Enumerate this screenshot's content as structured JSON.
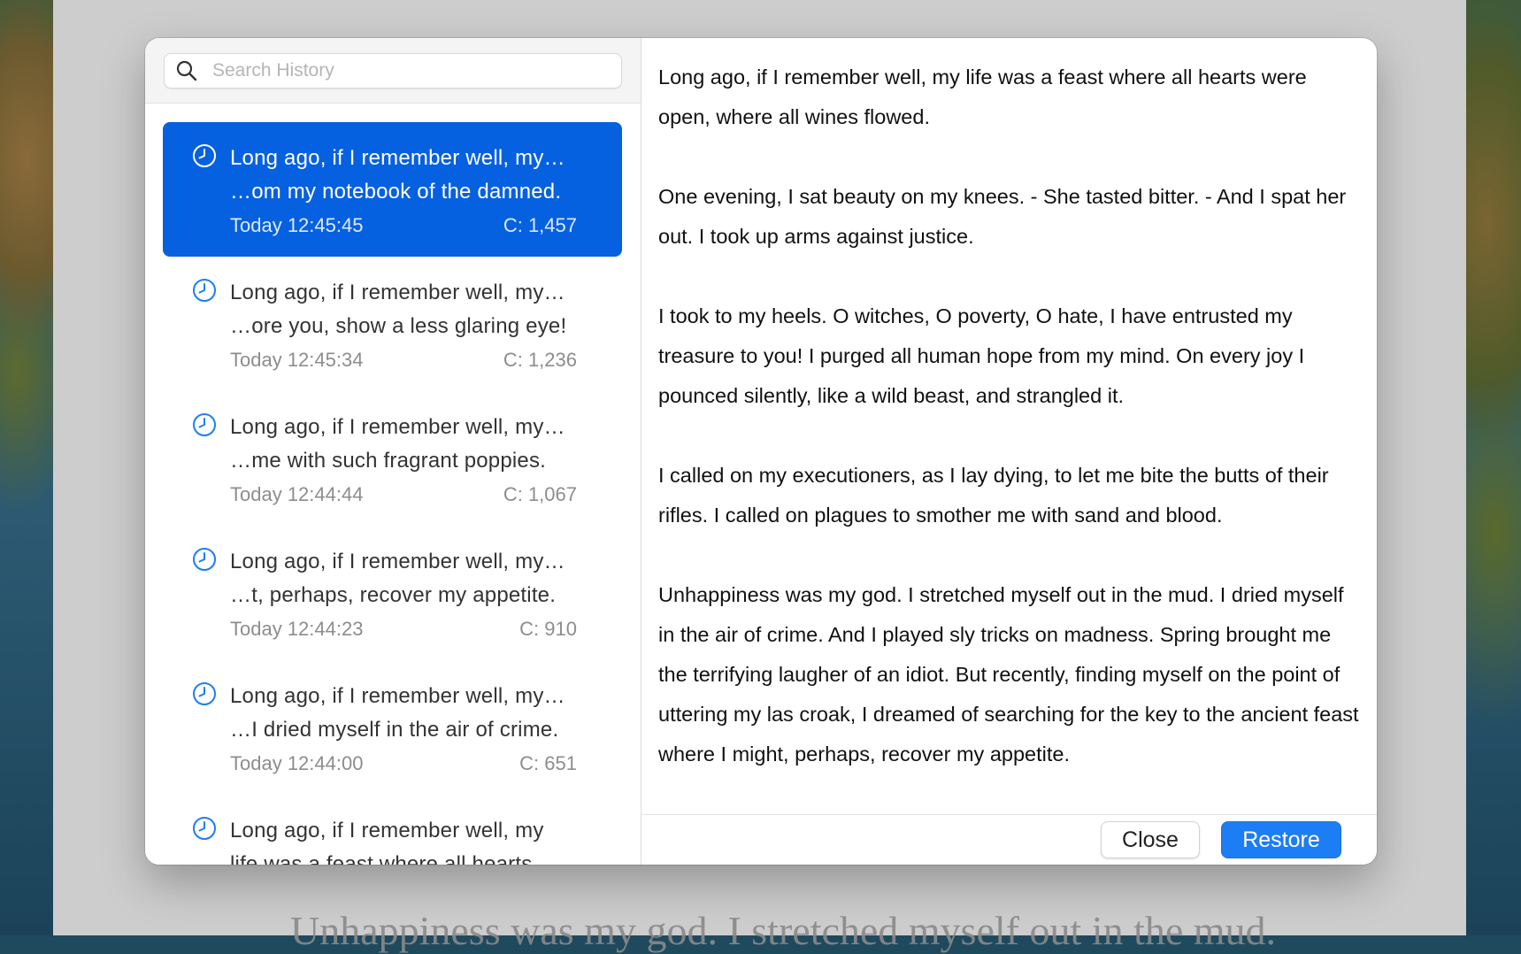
{
  "background": {
    "document_text": "Unhappiness was my god. I stretched myself out in the mud."
  },
  "search": {
    "placeholder": "Search History",
    "value": ""
  },
  "colors": {
    "accent": "#0661e0",
    "restore_button": "#1d7df5",
    "clock_icon": "#1d7df5"
  },
  "history": [
    {
      "line1": "Long ago, if I remember well, my…",
      "line2": "…om my notebook of the damned.",
      "time": "Today 12:45:45",
      "chars": "C: 1,457",
      "selected": true
    },
    {
      "line1": "Long ago, if I remember well, my…",
      "line2": "…ore you, show a less glaring eye!",
      "time": "Today 12:45:34",
      "chars": "C: 1,236",
      "selected": false
    },
    {
      "line1": "Long ago, if I remember well, my…",
      "line2": "…me with such fragrant poppies.",
      "time": "Today 12:44:44",
      "chars": "C: 1,067",
      "selected": false
    },
    {
      "line1": "Long ago, if I remember well, my…",
      "line2": "…t, perhaps, recover my appetite.",
      "time": "Today 12:44:23",
      "chars": "C: 910",
      "selected": false
    },
    {
      "line1": "Long ago, if I remember well, my…",
      "line2": "…I dried myself in the air of crime.",
      "time": "Today 12:44:00",
      "chars": "C: 651",
      "selected": false
    },
    {
      "line1": "Long ago, if I remember well, my",
      "line2": "life was a feast where all hearts…",
      "time": "",
      "chars": "",
      "selected": false
    }
  ],
  "preview": {
    "paragraphs": [
      "Long ago, if I remember well, my life was a feast where all hearts were open, where all wines flowed.",
      "One evening, I sat beauty on my knees. - She tasted bitter. - And I spat her out. I took up arms against justice.",
      "I took to my heels. O witches, O poverty, O hate, I have entrusted my treasure to you! I purged all human hope from my mind. On every joy I pounced silently, like a wild beast, and strangled it.",
      "I called on my executioners, as I lay dying, to let me bite the butts of their rifles. I called on plagues to smother me with sand and blood.",
      "Unhappiness was my god. I stretched myself out in the mud. I dried myself in the air of crime. And I played sly tricks on madness. Spring brought me the terrifying laugher of an idiot. But recently, finding myself on the point of uttering my las croak, I dreamed of searching for the key to the ancient feast where I might, perhaps, recover my appetite."
    ]
  },
  "buttons": {
    "close": "Close",
    "restore": "Restore"
  }
}
